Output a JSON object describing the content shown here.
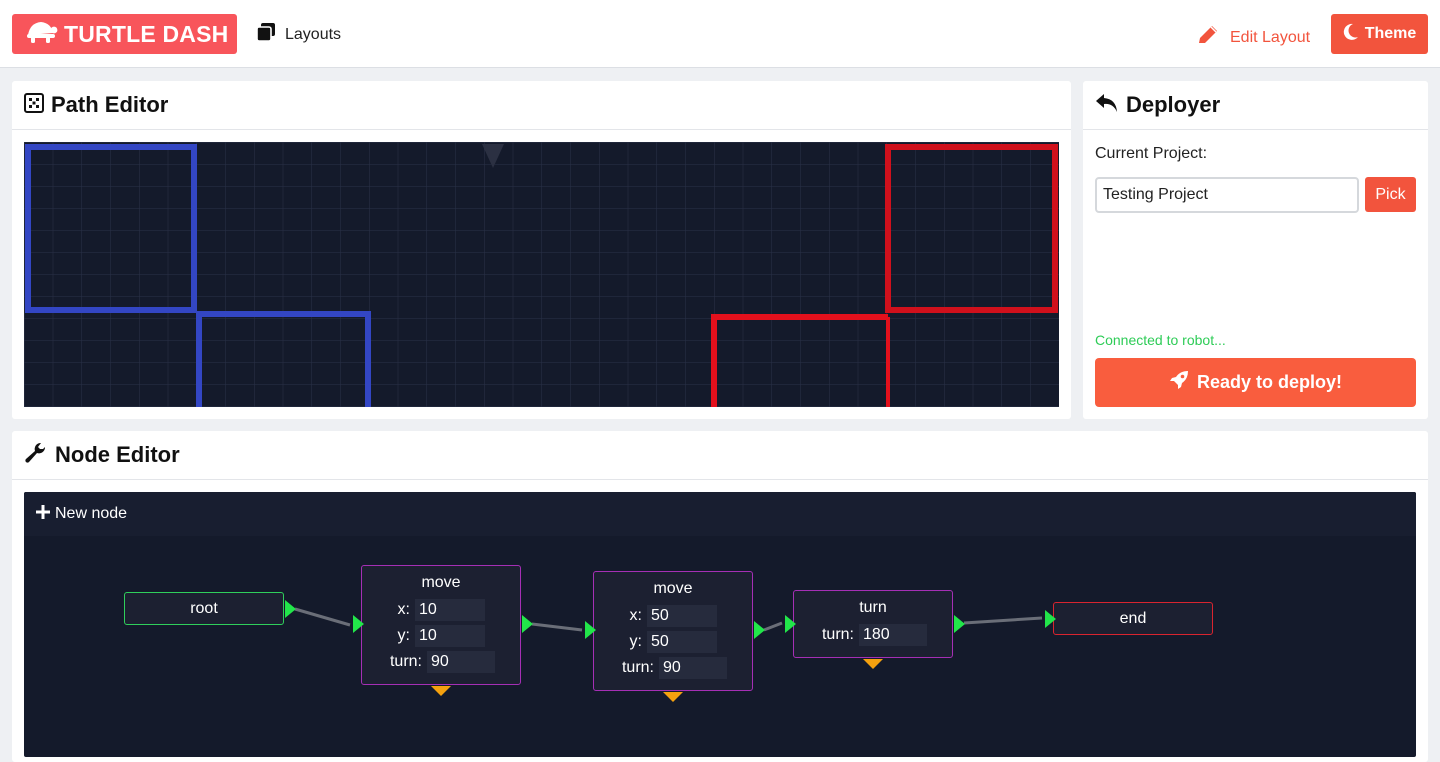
{
  "app": {
    "brand": "TURTLE DASH",
    "layouts_label": "Layouts",
    "edit_layout_label": "Edit Layout",
    "theme_label": "Theme",
    "accent_color": "#f2543d",
    "brand_color": "#f8555b"
  },
  "path_editor": {
    "title": "Path Editor",
    "icon": "grid-icon",
    "field_colors": {
      "blue": "#2c3fb0",
      "red": "#e3101c",
      "background": "#141a2b"
    }
  },
  "deployer": {
    "title": "Deployer",
    "icon": "reply-arrow-icon",
    "current_project_label": "Current Project:",
    "project_value": "Testing Project",
    "pick_label": "Pick",
    "status": "Connected to robot...",
    "deploy_label": "Ready to deploy!"
  },
  "node_editor": {
    "title": "Node Editor",
    "icon": "wrench-icon",
    "new_node_label": "New node",
    "nodes": [
      {
        "id": "root",
        "type": "root",
        "label": "root",
        "border_color": "#2fcf5b"
      },
      {
        "id": "move1",
        "type": "move",
        "title": "move",
        "params": [
          {
            "label": "x:",
            "value": "10"
          },
          {
            "label": "y:",
            "value": "10"
          },
          {
            "label": "turn:",
            "value": "90"
          }
        ],
        "border_color": "#a52fb5"
      },
      {
        "id": "move2",
        "type": "move",
        "title": "move",
        "params": [
          {
            "label": "x:",
            "value": "50"
          },
          {
            "label": "y:",
            "value": "50"
          },
          {
            "label": "turn:",
            "value": "90"
          }
        ],
        "border_color": "#a52fb5"
      },
      {
        "id": "turn1",
        "type": "turn",
        "title": "turn",
        "params": [
          {
            "label": "turn:",
            "value": "180"
          }
        ],
        "border_color": "#a52fb5"
      },
      {
        "id": "end",
        "type": "end",
        "label": "end",
        "border_color": "#d9242f"
      }
    ],
    "connections": [
      [
        "root",
        "move1"
      ],
      [
        "move1",
        "move2"
      ],
      [
        "move2",
        "turn1"
      ],
      [
        "turn1",
        "end"
      ]
    ]
  }
}
